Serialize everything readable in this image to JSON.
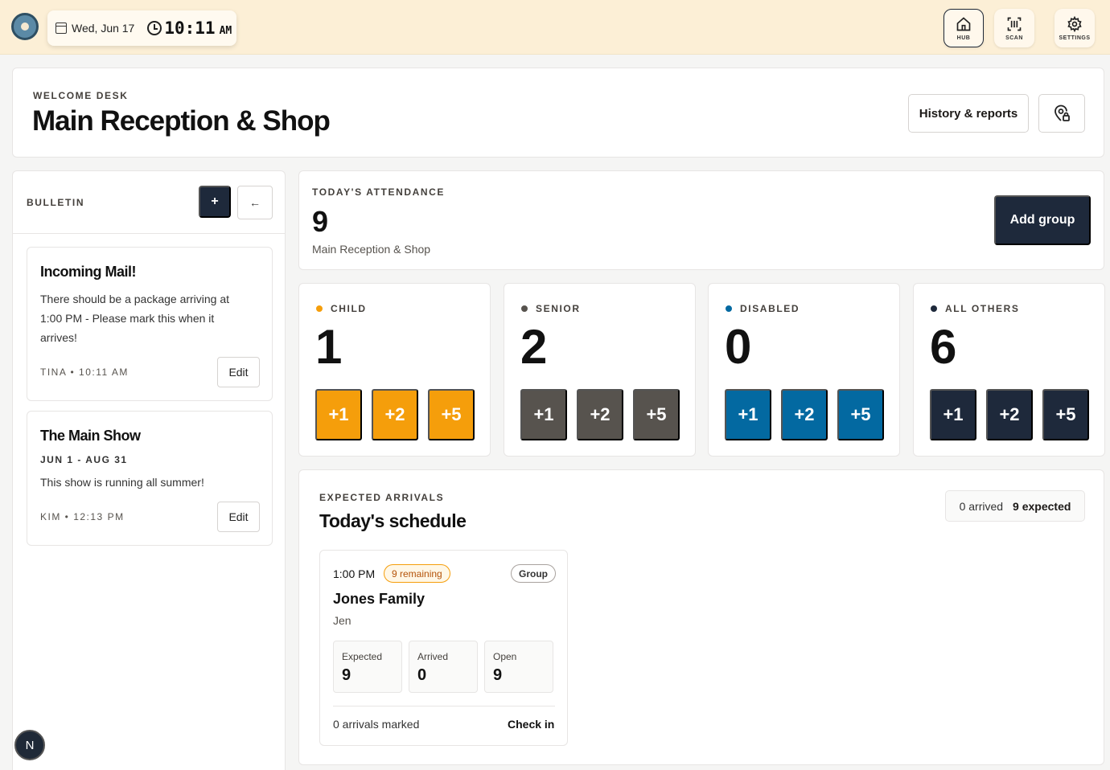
{
  "topbar": {
    "date": "Wed, Jun 17",
    "time": "10:11",
    "ampm": "AM",
    "nav": [
      {
        "label": "HUB",
        "icon": "home-icon"
      },
      {
        "label": "SCAN",
        "icon": "scan-icon"
      },
      {
        "label": "SETTINGS",
        "icon": "gear-icon"
      }
    ]
  },
  "header": {
    "eyebrow": "WELCOME DESK",
    "title": "Main Reception & Shop",
    "history_label": "History & reports"
  },
  "bulletin": {
    "title": "BULLETIN",
    "add_label": "+",
    "back_label": "←",
    "notes": [
      {
        "title": "Incoming Mail!",
        "body": "There should be a package arriving at 1:00 PM - Please mark this when it arrives!",
        "meta": "TINA • 10:11 AM",
        "edit_label": "Edit"
      },
      {
        "title": "The Main Show",
        "dates": "JUN 1 - AUG 31",
        "body": "This show is running all summer!",
        "meta": "KIM • 12:13 PM",
        "edit_label": "Edit"
      }
    ]
  },
  "attendance": {
    "eyebrow": "TODAY'S ATTENDANCE",
    "count": "9",
    "location": "Main Reception & Shop",
    "add_group_label": "Add group"
  },
  "categories": [
    {
      "label": "CHILD",
      "value": "1",
      "color": "#f59e0b",
      "incs": [
        "+1",
        "+2",
        "+5"
      ]
    },
    {
      "label": "SENIOR",
      "value": "2",
      "color": "#57534e",
      "incs": [
        "+1",
        "+2",
        "+5"
      ]
    },
    {
      "label": "DISABLED",
      "value": "0",
      "color": "#0369a1",
      "incs": [
        "+1",
        "+2",
        "+5"
      ]
    },
    {
      "label": "ALL OTHERS",
      "value": "6",
      "color": "#1e293b",
      "incs": [
        "+1",
        "+2",
        "+5"
      ]
    }
  ],
  "schedule": {
    "eyebrow": "EXPECTED ARRIVALS",
    "title": "Today's schedule",
    "arrived": "0 arrived",
    "expected": "9 expected",
    "event": {
      "time": "1:00 PM",
      "remaining": "9 remaining",
      "type": "Group",
      "name": "Jones Family",
      "host": "Jen",
      "stats": [
        {
          "label": "Expected",
          "value": "9"
        },
        {
          "label": "Arrived",
          "value": "0"
        },
        {
          "label": "Open",
          "value": "9"
        }
      ],
      "marked": "0 arrivals marked",
      "checkin_label": "Check in"
    }
  },
  "avatar_letter": "N"
}
